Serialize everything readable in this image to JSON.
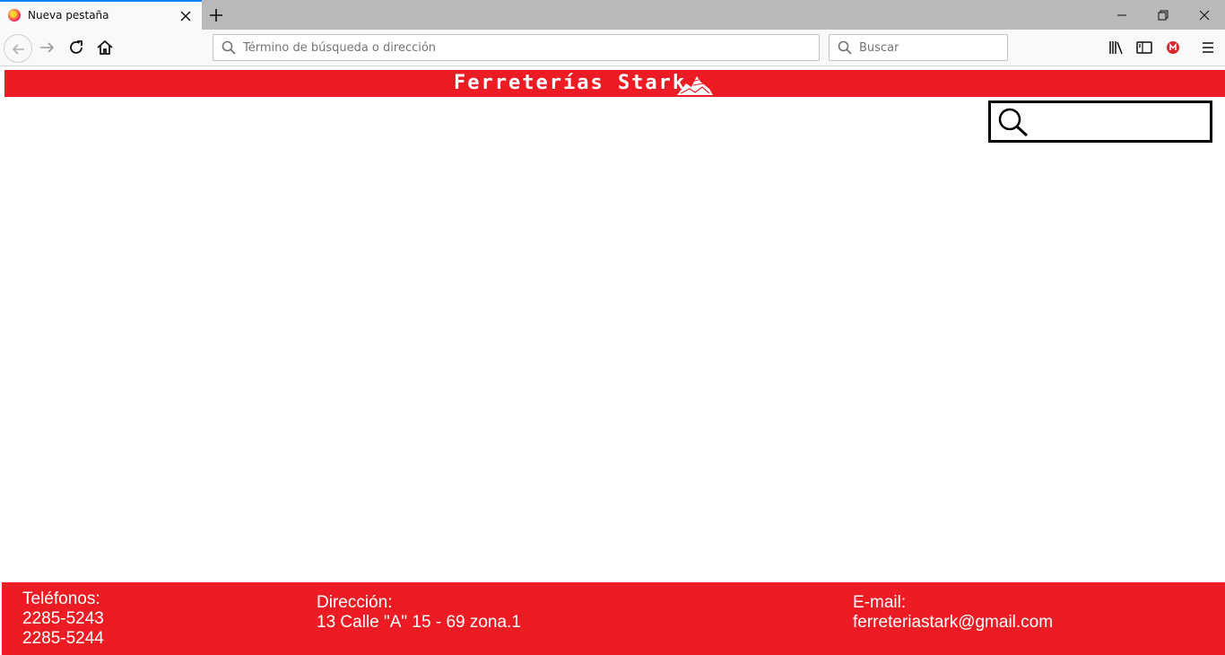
{
  "browser": {
    "tab": {
      "title": "Nueva pestaña"
    },
    "urlbar": {
      "placeholder": "Término de búsqueda o dirección"
    },
    "searchbar": {
      "placeholder": "Buscar"
    }
  },
  "site": {
    "title": "Ferreterías Stark",
    "brand_color": "#ed1c24",
    "footer": {
      "phones_label": "Teléfonos:",
      "phone_1": "2285-5243",
      "phone_2": "2285-5244",
      "address_label": "Dirección:",
      "address": "13 Calle \"A\" 15 - 69 zona.1",
      "email_label": "E-mail:",
      "email": "ferreteriastark@gmail.com"
    }
  },
  "icons": [
    "firefox-icon",
    "close-icon",
    "plus-icon",
    "minimize-icon",
    "restore-icon",
    "back-icon",
    "forward-icon",
    "reload-icon",
    "home-icon",
    "search-icon",
    "library-icon",
    "sidebar-icon",
    "mega-icon",
    "menu-icon",
    "magnifier-icon",
    "stark-logo-icon"
  ]
}
